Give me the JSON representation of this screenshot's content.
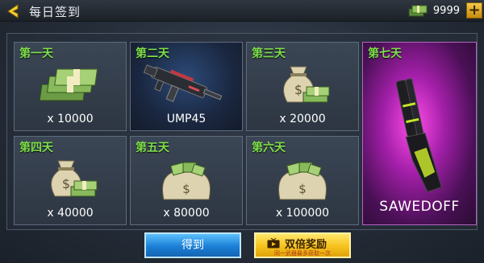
{
  "header": {
    "title": "每日签到",
    "currency_value": "9999",
    "add_label": "+"
  },
  "rewards": [
    {
      "day": "第一天",
      "amount": "x 10000",
      "icon": "cash-stack-icon"
    },
    {
      "day": "第二天",
      "amount": "UMP45",
      "icon": "ump45-gun-icon"
    },
    {
      "day": "第三天",
      "amount": "x 20000",
      "icon": "money-bag-icon"
    },
    {
      "day": "第四天",
      "amount": "x 40000",
      "icon": "money-bag-icon"
    },
    {
      "day": "第五天",
      "amount": "x 80000",
      "icon": "sack-of-cash-icon"
    },
    {
      "day": "第六天",
      "amount": "x 100000",
      "icon": "sack-of-cash-icon"
    },
    {
      "day": "第七天",
      "amount": "SAWEDOFF",
      "icon": "sawedoff-shotgun-icon"
    }
  ],
  "buttons": {
    "claim_label": "得到",
    "double_label": "双倍奖励",
    "double_sub": "同一武器最多获取一次"
  },
  "colors": {
    "day_label": "#7ee04b",
    "claim_button": "#1b7fd6",
    "double_button": "#f6c21c",
    "special_card": "#a21fa8"
  }
}
